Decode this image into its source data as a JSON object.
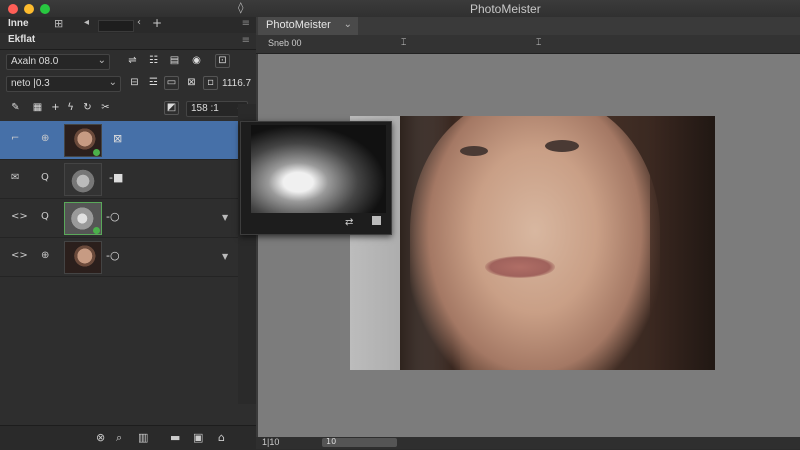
{
  "window": {
    "title": "PhotoMeister",
    "app_icon": "flame-icon"
  },
  "panel": {
    "tab_label": "Inne",
    "sub_tab_label": "Ekflat",
    "menu_glyph": "≡",
    "tab_arrow_left": "◂",
    "tab_arrow_right": "‹",
    "tab_plus": "+"
  },
  "toolbar1": {
    "blend_mode": "Axaln 08.0",
    "chevron": "⌄"
  },
  "toolbar2": {
    "opacity_value": "neto |0.3",
    "chevron": "⌄",
    "size_value": "1116.7"
  },
  "toolbar3": {
    "fill_value": "158 :1",
    "chevron": "⌄"
  },
  "layers": [
    {
      "visibility": "⌐",
      "lock": "⊕",
      "thumb": "face",
      "mask": "⊠",
      "selected": true
    },
    {
      "visibility": "✉",
      "lock": "Q",
      "thumb": "gray",
      "mask": "-■",
      "selected": false
    },
    {
      "visibility": "<>",
      "lock": "Q",
      "thumb": "gray2",
      "mask": "-○",
      "selected": false,
      "expand": "▼"
    },
    {
      "visibility": "<>",
      "lock": "⊕",
      "thumb": "face",
      "mask": "-○",
      "selected": false,
      "expand": "▼"
    }
  ],
  "document": {
    "tab_label": "PhotoMeister",
    "tab_chevron": "⌄",
    "ruler_text": "Sneb 00",
    "status_left": "1|10",
    "status_right": "10"
  }
}
